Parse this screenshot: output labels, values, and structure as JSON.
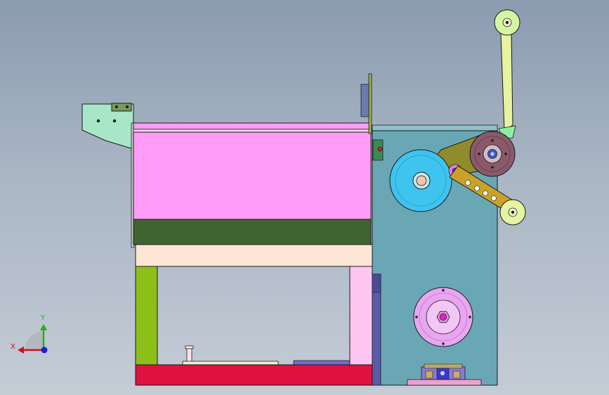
{
  "triad": {
    "x_label": "X",
    "y_label": "Y"
  },
  "colors": {
    "edge": "#1a1a1a",
    "mint": "#a8e6c8",
    "pink": "#ff9cf7",
    "dark_green": "#3f6430",
    "cream": "#fde6d6",
    "lime": "#8cbf1a",
    "light_pink": "#fdc6f0",
    "crimson": "#e0103f",
    "teal": "#6aa7b4",
    "sky_blue": "#3fc4f0",
    "olive": "#8f8c2c",
    "brown": "#8a5a6a",
    "pale_yellow_green": "#e6f3a0",
    "lavender": "#e9a6f0",
    "purple": "#6a6abf",
    "axis_red": "#d0101a",
    "axis_green": "#20b020",
    "axis_blue": "#2020d0"
  }
}
